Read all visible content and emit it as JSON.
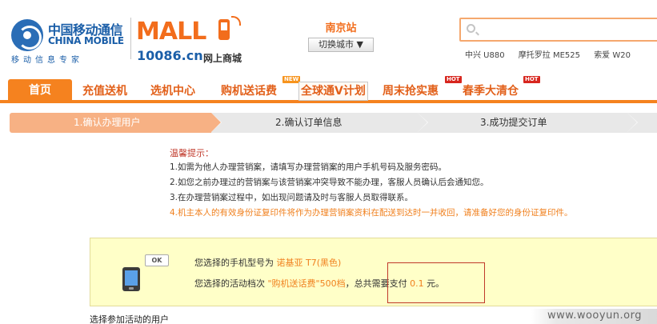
{
  "brand": {
    "cm_name_cn": "中国移动通信",
    "cm_name_en": "CHINA MOBILE",
    "cm_slogan": "移动信息专家",
    "mall_word": "MALL",
    "mall_site": "10086.cn",
    "mall_site_cn": "网上商城"
  },
  "city": {
    "name": "南京站",
    "switch_label": "切换城市 ▼"
  },
  "search": {
    "value": "",
    "placeholder": ""
  },
  "hotwords": [
    "中兴 U880",
    "摩托罗拉 ME525",
    "索爱 W20"
  ],
  "nav": {
    "items": [
      {
        "label": "首页"
      },
      {
        "label": "充值送机"
      },
      {
        "label": "选机中心"
      },
      {
        "label": "购机送话费",
        "badge": "NEW"
      },
      {
        "label": "全球通V计划"
      },
      {
        "label": "周末抢实惠",
        "badge": "HOT"
      },
      {
        "label": "春季大清仓",
        "badge": "HOT"
      }
    ]
  },
  "steps": [
    {
      "label": "1.确认办理用户",
      "active": true
    },
    {
      "label": "2.确认订单信息",
      "active": false
    },
    {
      "label": "3.成功提交订单",
      "active": false
    }
  ],
  "tips": {
    "title": "温馨提示：",
    "lines": [
      "1.如需为他人办理营销案，请填写办理营销案的用户手机号码及服务密码。",
      "2.如您之前办理过的营销案与该营销案冲突导致不能办理，客服人员确认后会通知您。",
      "3.在办理营销案过程中，如出现问题请及时与客服人员取得联系。",
      "4.机主本人的有效身份证复印件将作为办理营销案资料在配送到达时一并收回，请准备好您的身份证复印件。"
    ]
  },
  "selection": {
    "ok_label": "OK",
    "phone_prefix": "您选择的手机型号为",
    "phone_model": "诺基亚 T7(黑色)",
    "plan_prefix": "您选择的活动档次",
    "plan_name": "\"购机送话费\"500档",
    "pay_prefix": "，总共需要支付",
    "pay_amount": "0.1",
    "pay_unit": "元。"
  },
  "bottom_label": "选择参加活动的用户",
  "watermark": "www.wooyun.org",
  "colors": {
    "accent_orange": "#f5821f",
    "brand_blue": "#1a5ea8",
    "hot_red": "#d7261e",
    "info_bg": "#ffffc8"
  }
}
